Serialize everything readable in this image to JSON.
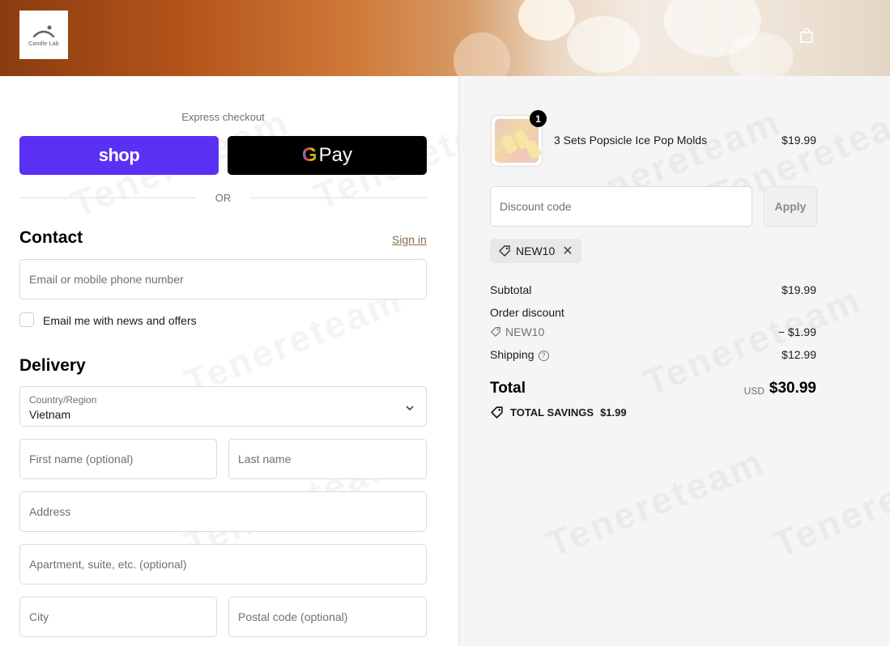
{
  "header": {
    "logo_text": "Candle Lab",
    "cart_icon": "shopping-bag-icon"
  },
  "express": {
    "title": "Express checkout",
    "shop_label": "shop",
    "gpay_g": "G",
    "gpay_label": "Pay",
    "or_label": "OR"
  },
  "contact": {
    "heading": "Contact",
    "signin_label": "Sign in",
    "email_placeholder": "Email or mobile phone number",
    "news_label": "Email me with news and offers"
  },
  "delivery": {
    "heading": "Delivery",
    "country_label": "Country/Region",
    "country_value": "Vietnam",
    "first_name_placeholder": "First name (optional)",
    "last_name_placeholder": "Last name",
    "address_placeholder": "Address",
    "apartment_placeholder": "Apartment, suite, etc. (optional)",
    "city_placeholder": "City",
    "postal_placeholder": "Postal code (optional)"
  },
  "order": {
    "item": {
      "quantity": "1",
      "name": "3 Sets Popsicle Ice Pop Molds",
      "price": "$19.99"
    },
    "discount_placeholder": "Discount code",
    "apply_label": "Apply",
    "applied_code": "NEW10",
    "remove_icon": "close-icon",
    "subtotal_label": "Subtotal",
    "subtotal_value": "$19.99",
    "order_discount_label": "Order discount",
    "discount_code_label": "NEW10",
    "discount_value": "− $1.99",
    "shipping_label": "Shipping",
    "shipping_help": "?",
    "shipping_value": "$12.99",
    "total_label": "Total",
    "total_currency": "USD",
    "total_value": "$30.99",
    "savings_label": "TOTAL SAVINGS",
    "savings_value": "$1.99"
  },
  "watermark": "Tenereteam",
  "colors": {
    "shop_purple": "#5a31f4",
    "gpay_black": "#000000",
    "signin_link": "#8b6b4a",
    "summary_bg": "#f5f5f5"
  }
}
